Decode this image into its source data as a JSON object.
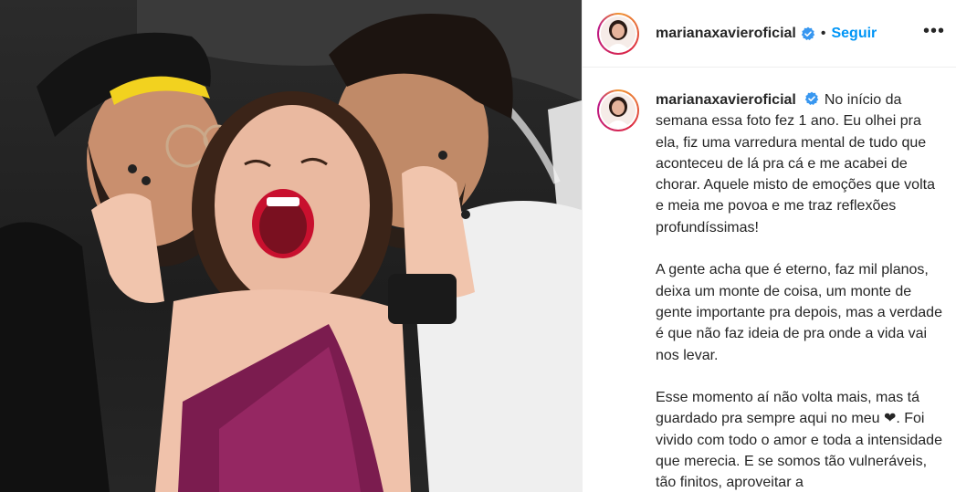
{
  "post": {
    "username": "marianaxavieroficial",
    "separator": "•",
    "follow_label": "Seguir",
    "more_label": "•••",
    "verified_icon": "verified-badge-icon",
    "colors": {
      "accent": "#0095f6",
      "verified": "#3897f0",
      "text": "#262626"
    }
  },
  "caption": {
    "username": "marianaxavieroficial",
    "paragraphs": [
      "No início da semana essa foto fez 1 ano. Eu olhei pra ela, fiz uma varredura mental de tudo que aconteceu de lá pra cá e me acabei de chorar. Aquele misto de emoções que volta e meia me povoa e me traz reflexões profundíssimas!",
      "A gente acha que é eterno, faz mil planos, deixa um monte de coisa, um monte de gente importante pra depois, mas a verdade é que não faz ideia de pra onde a vida vai nos levar.",
      "Esse momento aí não volta mais, mas tá guardado pra sempre aqui no meu ❤. Foi vivido com todo o amor e toda a intensidade que merecia. E se somos tão vulneráveis, tão finitos, aproveitar a"
    ]
  }
}
